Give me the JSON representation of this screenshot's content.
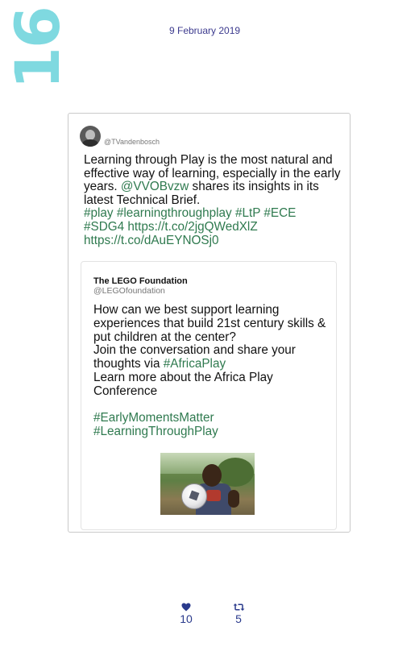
{
  "page_number": "16",
  "date": "9 February 2019",
  "tweet": {
    "handle": "@TVandenbosch",
    "text_before_mention": "Learning through Play is the most natural and effective way of learning, especially in the early years. ",
    "mention": "@VVOBvzw",
    "text_after_mention": " shares its insights in its latest Technical Brief.\n",
    "hashtags": "#play #learningthroughplay #LtP #ECE\n#SDG4 https://t.co/2jgQWedXlZ\nhttps://t.co/dAuEYNOSj0",
    "avatar_icon": "profile-photo"
  },
  "quoted_tweet": {
    "name": "The LEGO Foundation",
    "handle": "@LEGOfoundation",
    "text_part1": "How can we best support learning experiences that build 21st century skills & put children at the center?\nJoin the conversation and share your thoughts via ",
    "hashtag_inline": "#AfricaPlay",
    "text_part2": "\nLearn more about the Africa Play Conference\n\n",
    "hashtags_end": "#EarlyMomentsMatter\n#LearningThroughPlay",
    "photo_icon": "child-with-football-photo"
  },
  "actions": {
    "likes": "10",
    "retweets": "5",
    "like_icon": "heart-icon",
    "retweet_icon": "retweet-icon"
  },
  "colors": {
    "page_number": "#7fd9e0",
    "date": "#3c3a8e",
    "hashtag": "#2f7a4f",
    "action": "#2a3a8c"
  }
}
